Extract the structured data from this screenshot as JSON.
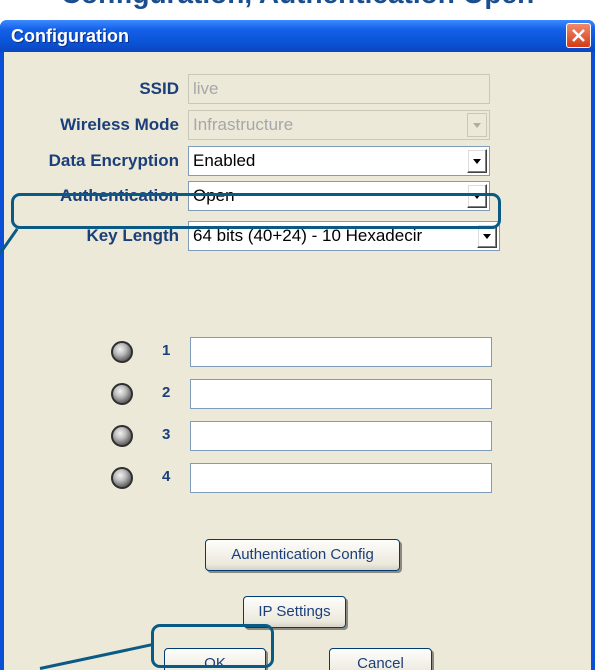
{
  "caption": {
    "text": "Configuration, Authentication Open"
  },
  "window": {
    "title": "Configuration",
    "close_icon": "close-x-icon"
  },
  "form": {
    "ssid": {
      "label": "SSID",
      "value": "live",
      "disabled": true
    },
    "wireless_mode": {
      "label": "Wireless Mode",
      "value": "Infrastructure",
      "disabled": true
    },
    "data_encryption": {
      "label": "Data Encryption",
      "value": "Enabled"
    },
    "authentication": {
      "label": "Authentication",
      "value": "Open"
    },
    "key_length": {
      "label": "Key Length",
      "value": "64 bits (40+24) - 10 Hexadecir"
    }
  },
  "keys": [
    {
      "number": "1",
      "value": ""
    },
    {
      "number": "2",
      "value": ""
    },
    {
      "number": "3",
      "value": ""
    },
    {
      "number": "4",
      "value": ""
    }
  ],
  "buttons": {
    "auth_config": "Authentication Config",
    "ip_settings": "IP Settings",
    "ok": "OK",
    "cancel": "Cancel"
  },
  "colors": {
    "title_bar": "#0a53d6",
    "dialog_bg": "#ece9d8",
    "label_text": "#1b3f7a",
    "callout": "#0a5a86",
    "close_button": "#d63a16"
  }
}
